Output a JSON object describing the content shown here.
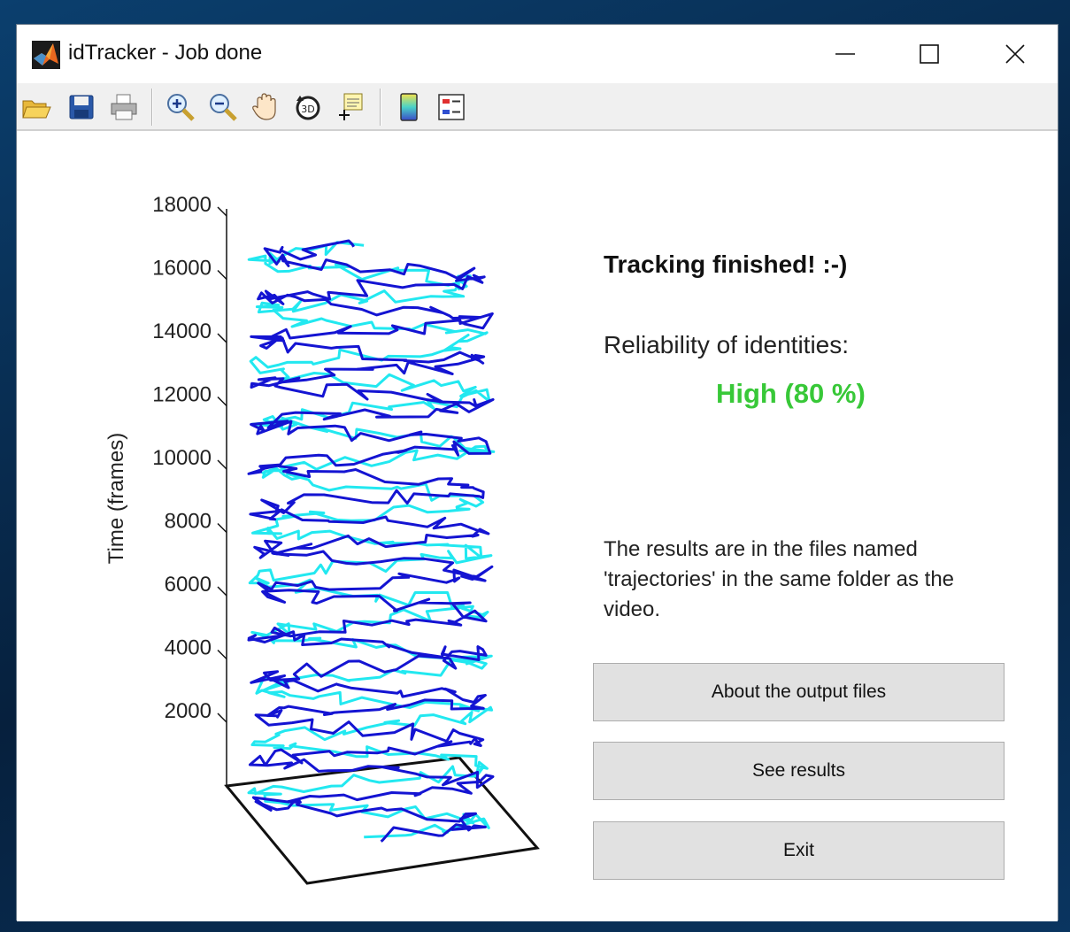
{
  "window": {
    "title": "idTracker - Job done"
  },
  "title_bar_buttons": [
    "minimize-icon",
    "maximize-icon",
    "close-icon"
  ],
  "toolbar": {
    "icons": [
      "open-folder-icon",
      "save-icon",
      "print-icon",
      "zoom-in-icon",
      "zoom-out-icon",
      "pan-hand-icon",
      "rotate-3d-icon",
      "data-cursor-icon",
      "colorbar-icon",
      "legend-icon"
    ]
  },
  "plot": {
    "ylabel": "Time (frames)",
    "yticks": [
      "18000",
      "16000",
      "14000",
      "12000",
      "10000",
      "8000",
      "6000",
      "4000",
      "2000"
    ],
    "series_colors": {
      "individual_1": "#1414d2",
      "individual_2": "#22e8f0"
    }
  },
  "chart_data": {
    "type": "line",
    "subtype": "3d-trajectories",
    "ylabel": "Time (frames)",
    "zlim": [
      0,
      18000
    ],
    "series": [
      {
        "color": "#1414d2"
      },
      {
        "color": "#22e8f0"
      }
    ]
  },
  "status": {
    "title": "Tracking finished! :-)",
    "reliability_label": "Reliability of identities:",
    "reliability_value": "High (80 %)",
    "reliability_color": "#38c838",
    "results_text": "The results are in the files named 'trajectories' in the same folder as the video."
  },
  "buttons": {
    "about": "About the output files",
    "see_results": "See results",
    "exit": "Exit"
  }
}
